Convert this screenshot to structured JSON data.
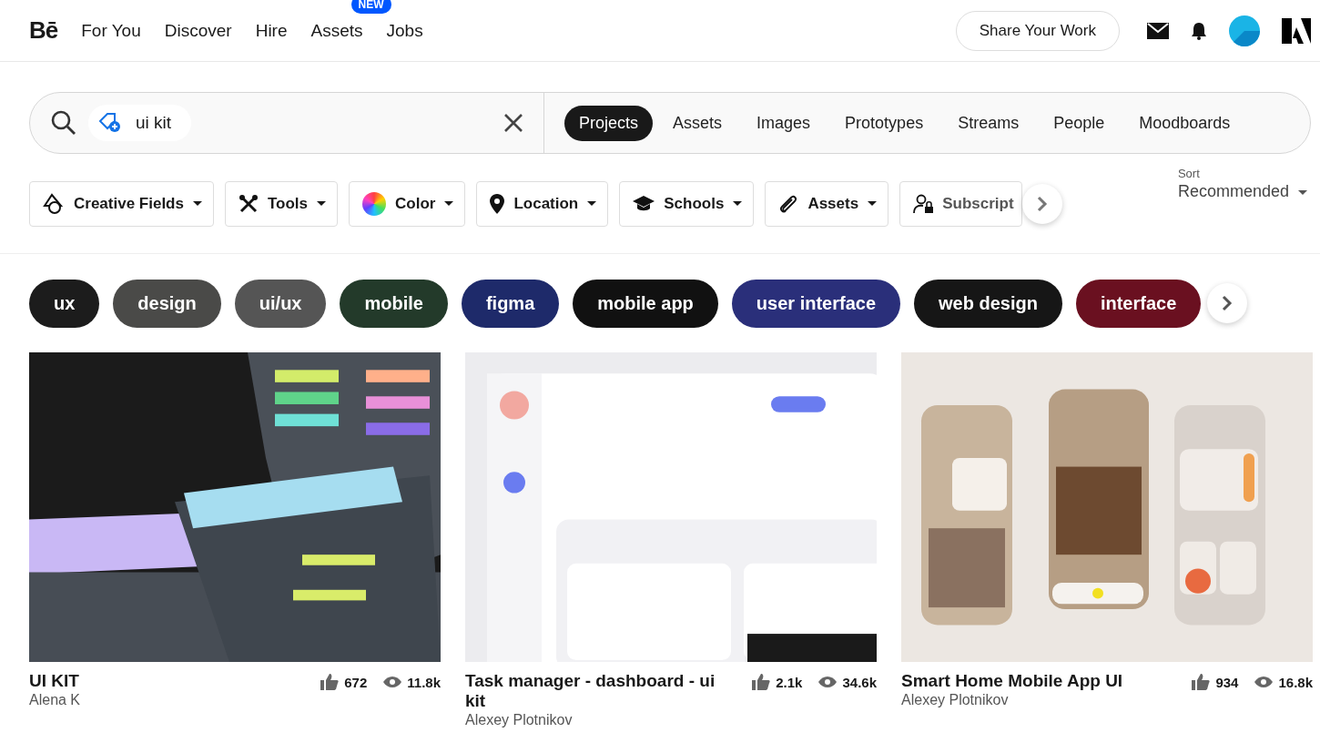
{
  "header": {
    "logo": "Bē",
    "nav": [
      {
        "label": "For You"
      },
      {
        "label": "Discover"
      },
      {
        "label": "Hire"
      },
      {
        "label": "Assets",
        "badge": "NEW"
      },
      {
        "label": "Jobs"
      }
    ],
    "share_button": "Share Your Work"
  },
  "search": {
    "query": "ui kit",
    "tabs": [
      {
        "label": "Projects",
        "selected": true
      },
      {
        "label": "Assets",
        "selected": false
      },
      {
        "label": "Images",
        "selected": false
      },
      {
        "label": "Prototypes",
        "selected": false
      },
      {
        "label": "Streams",
        "selected": false
      },
      {
        "label": "People",
        "selected": false
      },
      {
        "label": "Moodboards",
        "selected": false
      }
    ]
  },
  "filters": [
    {
      "kind": "fields",
      "label": "Creative Fields"
    },
    {
      "kind": "tools",
      "label": "Tools"
    },
    {
      "kind": "color",
      "label": "Color"
    },
    {
      "kind": "location",
      "label": "Location"
    },
    {
      "kind": "schools",
      "label": "Schools"
    },
    {
      "kind": "assets",
      "label": "Assets"
    },
    {
      "kind": "subscription",
      "label": "Subscript"
    }
  ],
  "sort": {
    "label": "Sort",
    "value": "Recommended"
  },
  "tags": [
    "ux",
    "design",
    "ui/ux",
    "mobile",
    "figma",
    "mobile app",
    "user interface",
    "web design",
    "interface"
  ],
  "projects": [
    {
      "title": "UI KIT",
      "author": "Alena K",
      "likes": "672",
      "views": "11.8k"
    },
    {
      "title": "Task manager - dashboard - ui kit",
      "author": "Alexey Plotnikov",
      "likes": "2.1k",
      "views": "34.6k"
    },
    {
      "title": "Smart Home Mobile App UI",
      "author": "Alexey Plotnikov",
      "likes": "934",
      "views": "16.8k"
    }
  ]
}
